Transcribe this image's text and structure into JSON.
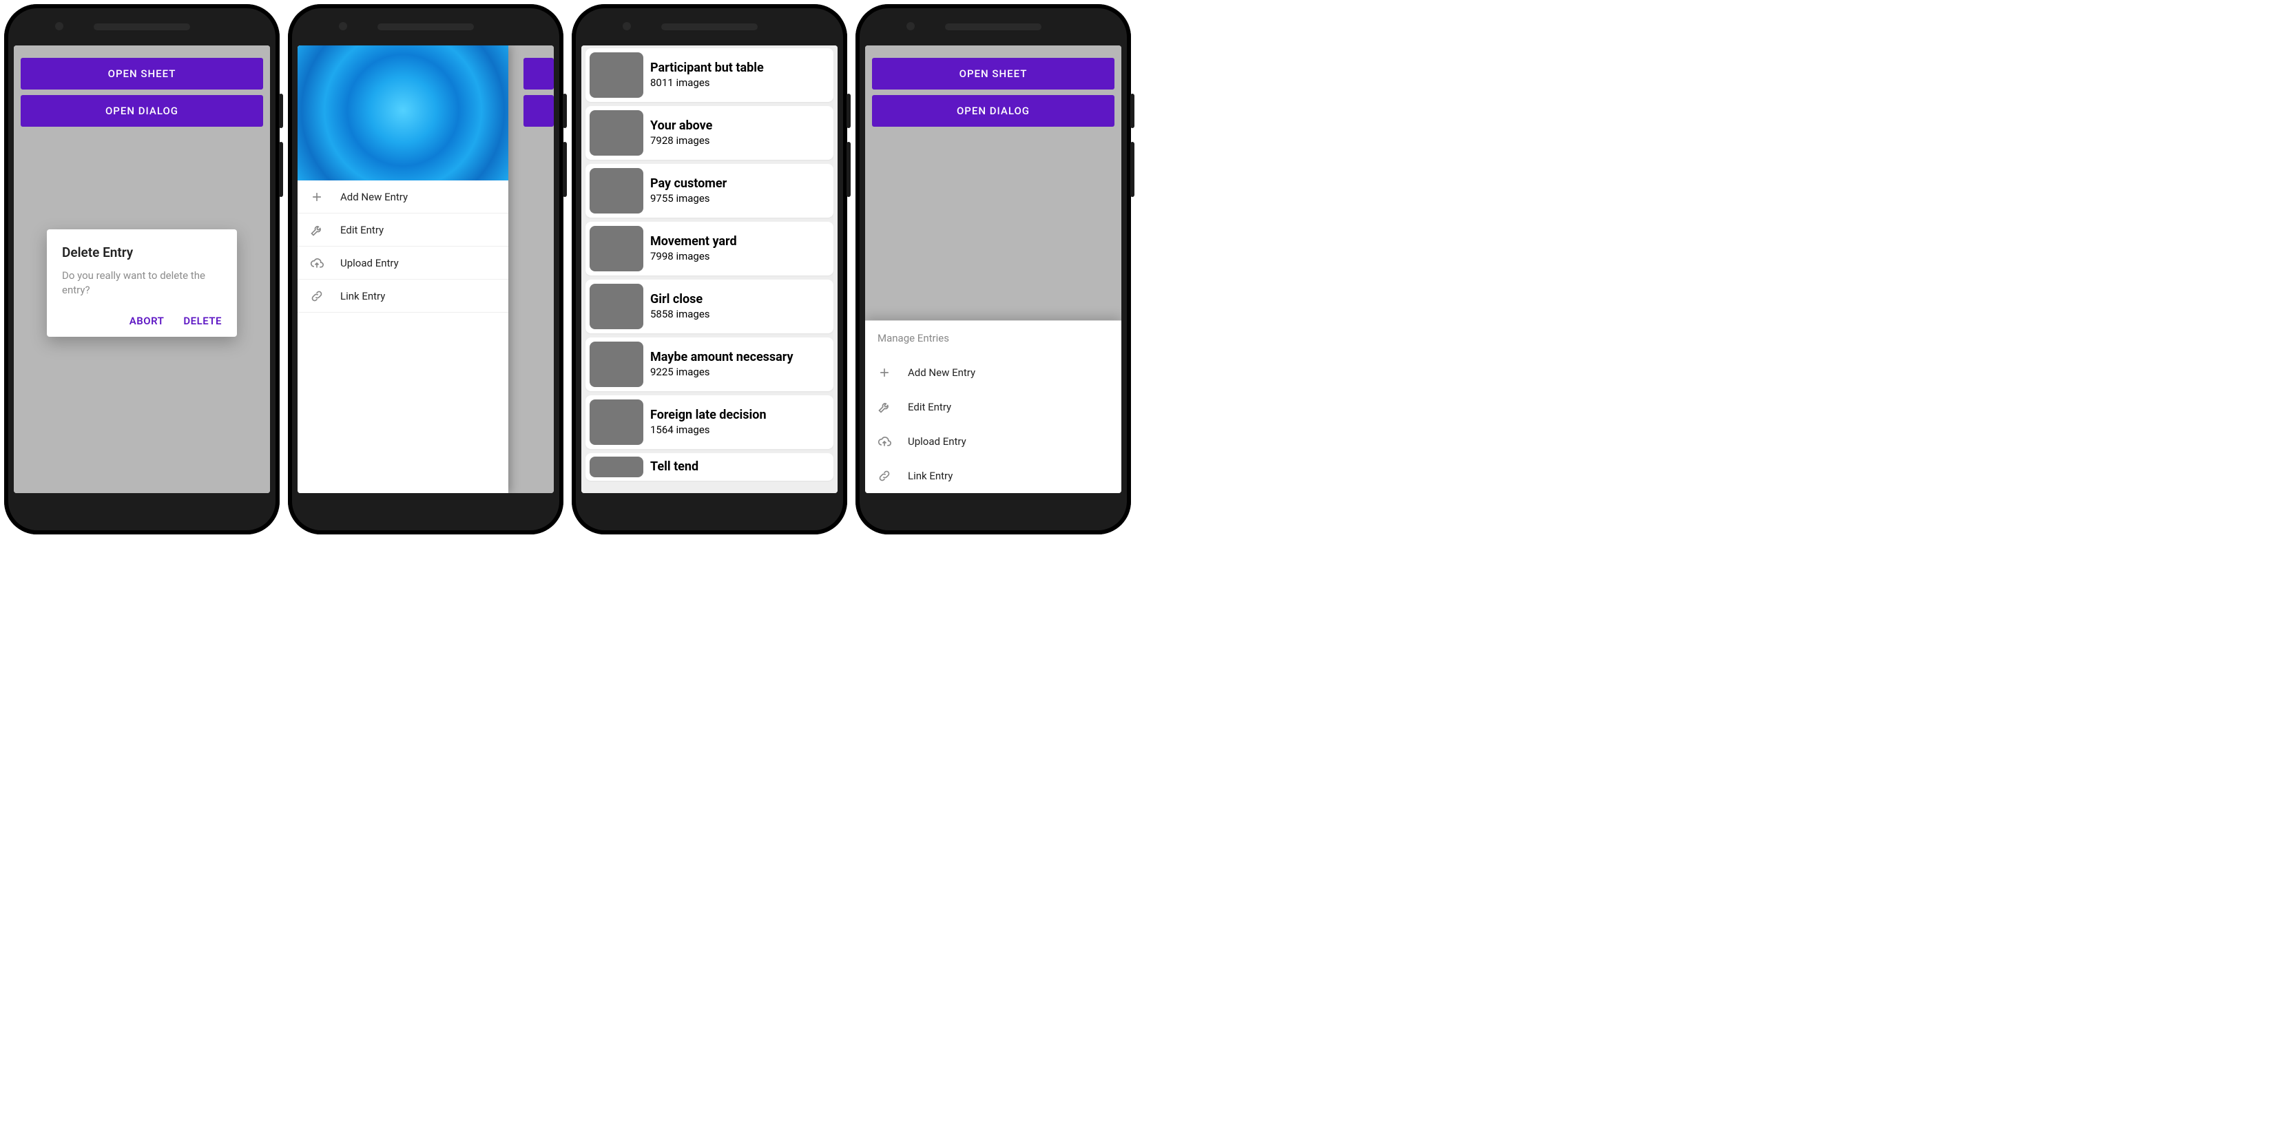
{
  "buttons": {
    "open_sheet": "OPEN SHEET",
    "open_dialog": "OPEN DIALOG"
  },
  "dialog": {
    "title": "Delete Entry",
    "body": "Do you really want to delete the entry?",
    "abort": "ABORT",
    "delete": "DELETE"
  },
  "drawer": {
    "items": [
      {
        "icon": "plus",
        "label": "Add New Entry"
      },
      {
        "icon": "wrench",
        "label": "Edit Entry"
      },
      {
        "icon": "cloud-upload",
        "label": "Upload Entry"
      },
      {
        "icon": "link",
        "label": "Link Entry"
      }
    ]
  },
  "list": [
    {
      "title": "Participant but table",
      "sub": "8011 images"
    },
    {
      "title": "Your above",
      "sub": "7928 images"
    },
    {
      "title": "Pay customer",
      "sub": "9755 images"
    },
    {
      "title": "Movement yard",
      "sub": "7998 images"
    },
    {
      "title": "Girl close",
      "sub": "5858 images"
    },
    {
      "title": "Maybe amount necessary",
      "sub": "9225 images"
    },
    {
      "title": "Foreign late decision",
      "sub": "1564 images"
    },
    {
      "title": "Tell tend",
      "sub": ""
    }
  ],
  "sheet": {
    "title": "Manage Entries",
    "items": [
      {
        "icon": "plus",
        "label": "Add New Entry"
      },
      {
        "icon": "wrench",
        "label": "Edit Entry"
      },
      {
        "icon": "cloud-upload",
        "label": "Upload Entry"
      },
      {
        "icon": "link",
        "label": "Link Entry"
      }
    ]
  }
}
